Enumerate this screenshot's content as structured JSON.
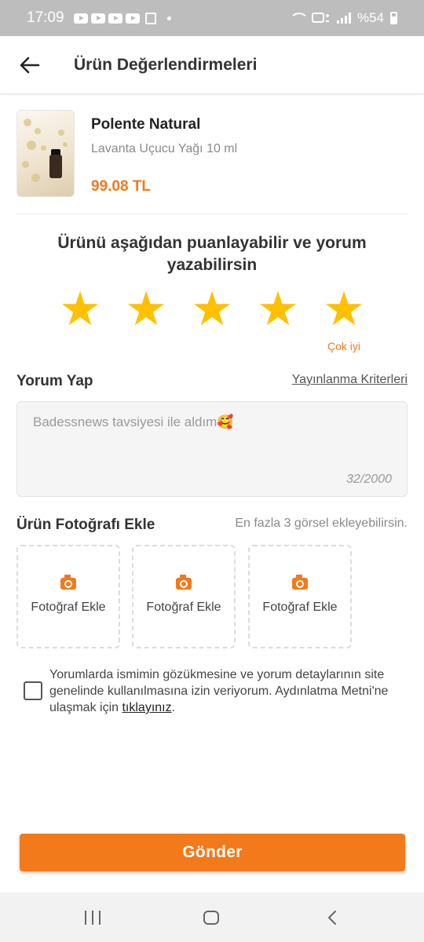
{
  "status_bar": {
    "time": "17:09",
    "battery_text": "%54",
    "icons": [
      "youtube-icon",
      "youtube-icon",
      "youtube-icon",
      "youtube-icon",
      "box-icon",
      "wifi-icon",
      "volte-icon",
      "signal-icon",
      "battery-icon"
    ]
  },
  "header": {
    "title": "Ürün Değerlendirmeleri",
    "back_icon": "arrow-left-icon"
  },
  "product": {
    "brand": "Polente Natural",
    "name": "Lavanta Uçucu Yağı 10 ml",
    "price": "99.08 TL"
  },
  "rating": {
    "prompt_line1": "Ürünü aşağıdan puanlayabilir ve yorum",
    "prompt_line2": "yazabilirsin",
    "value": 5,
    "max": 5,
    "caption": "Çok iyi",
    "star_color": "#FFC000"
  },
  "comment": {
    "section_title": "Yorum Yap",
    "criteria_link": "Yayınlanma Kriterleri",
    "text": "Badessnews tavsiyesi ile aldım🥰",
    "counter": "32/2000"
  },
  "photos": {
    "section_title": "Ürün Fotoğrafı Ekle",
    "hint": "En fazla 3 görsel ekleyebilirsin.",
    "slots": [
      {
        "label": "Fotoğraf Ekle"
      },
      {
        "label": "Fotoğraf Ekle"
      },
      {
        "label": "Fotoğraf Ekle"
      }
    ]
  },
  "consent": {
    "checked": false,
    "text": "Yorumlarda ismimin gözükmesine ve yorum detaylarının site genelinde kullanılmasına izin veriyorum. Aydınlatma Metni'ne ulaşmak için ",
    "link": "tıklayınız",
    "suffix": "."
  },
  "submit": {
    "label": "Gönder"
  },
  "colors": {
    "accent": "#F27A1A",
    "star": "#FFC000",
    "status_bar": "#BDBDBD"
  }
}
